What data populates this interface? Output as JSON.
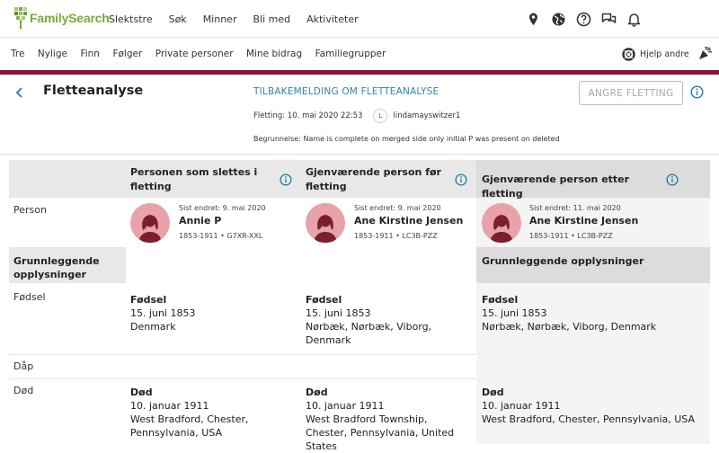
{
  "header": {
    "logo_text": "FamilySearch",
    "nav": [
      "Slektstre",
      "Søk",
      "Minner",
      "Bli med",
      "Aktiviteter"
    ],
    "icons": [
      "location-pin-icon",
      "globe-icon",
      "help-circle-icon",
      "chat-icon",
      "bell-icon"
    ]
  },
  "subnav": {
    "items": [
      "Tre",
      "Nylige",
      "Finn",
      "Følger",
      "Private personer",
      "Mine bidrag",
      "Familiegrupper"
    ],
    "help_others": "Hjelp andre"
  },
  "page": {
    "title": "Fletteanalyse",
    "feedback_link": "TILBAKEMELDING OM FLETTEANALYSE",
    "merge_label": "Fletting: 10. mai 2020 22:53",
    "user_initial": "L",
    "user_name": "lindamayswitzer1",
    "reason": "Begrunnelse: Name is complete on merged side only initial P was present on deleted",
    "undo_button": "ANGRE FLETTING"
  },
  "columns": {
    "deleted": "Personen som slettes i fletting",
    "before": "Gjenværende person før fletting",
    "after": "Gjenværende person etter fletting"
  },
  "rows": {
    "person": "Person",
    "basic_info": "Grunnleggende opplysninger",
    "birth": "Fødsel",
    "christening": "Dåp",
    "death": "Død"
  },
  "persons": {
    "deleted": {
      "changed": "Sist endret: 9. mai 2020",
      "name": "Annie P",
      "ids": "1853-1911 • G7XR-XXL"
    },
    "before": {
      "changed": "Sist endret: 9. mai 2020",
      "name": "Ane Kirstine Jensen",
      "ids": "1853-1911 • LC3B-PZZ"
    },
    "after": {
      "changed": "Sist endret: 11. mai 2020",
      "name": "Ane Kirstine Jensen",
      "ids": "1853-1911 • LC3B-PZZ"
    }
  },
  "after_section_label": "Grunnleggende opplysninger",
  "birth": {
    "deleted": {
      "title": "Fødsel",
      "date": "15. juni 1853",
      "place": "Denmark"
    },
    "before": {
      "title": "Fødsel",
      "date": "15. juni 1853",
      "place": "Nørbæk, Nørbæk, Viborg, Denmark"
    },
    "after": {
      "title": "Fødsel",
      "date": "15. juni 1853",
      "place": "Nørbæk, Nørbæk, Viborg, Denmark"
    }
  },
  "death": {
    "deleted": {
      "title": "Død",
      "date": "10. januar 1911",
      "place": "West Bradford, Chester, Pennsylvania, USA"
    },
    "before": {
      "title": "Død",
      "date": "10. januar 1911",
      "place": "West Bradford Township, Chester, Pennsylvania, United States"
    },
    "after": {
      "title": "Død",
      "date": "10. januar 1911",
      "place": "West Bradford, Chester, Pennsylvania, USA"
    }
  },
  "colors": {
    "brand_green": "#7ba83a",
    "accent_maroon": "#8a1538",
    "link_blue": "#2f87a4",
    "avatar_pink": "#e8a3a8",
    "avatar_dark": "#7a1f2b"
  }
}
